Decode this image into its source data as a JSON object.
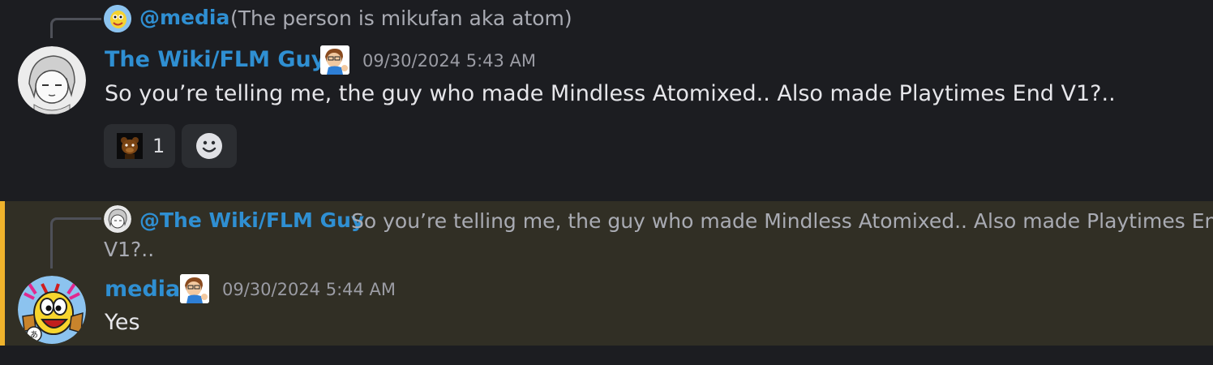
{
  "messages": [
    {
      "reply": {
        "name": "@media",
        "text": "(The person is mikufan aka atom)"
      },
      "author": "The Wiki/FLM Guy",
      "timestamp": "09/30/2024 5:43 AM",
      "content": "So you’re telling me, the guy who made Mindless Atomixed.. Also made Playtimes End V1?..",
      "reactions": [
        {
          "emoji": "bear-emoji",
          "count": "1"
        }
      ],
      "add_reaction_icon": "smiley-icon"
    },
    {
      "reply": {
        "name": "@The Wiki/FLM Guy",
        "text_line1": "So you’re telling me, the guy who made Mindless Atomixed.. Also made Playtimes End",
        "text_line2": "V1?.."
      },
      "author": "media",
      "timestamp": "09/30/2024 5:44 AM",
      "content": "Yes"
    }
  ],
  "colors": {
    "background": "#1c1d21",
    "mention_highlight": "#312f25",
    "mention_bar": "#efb32c",
    "username": "#2f8fd2",
    "timestamp": "#9b9ca4"
  }
}
